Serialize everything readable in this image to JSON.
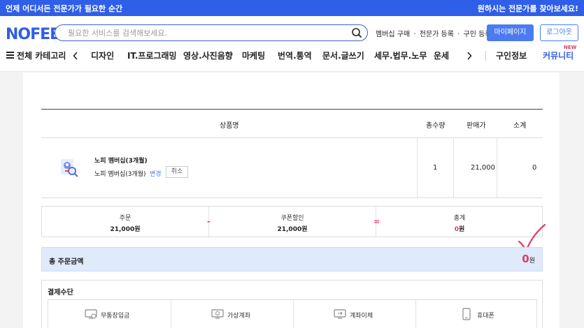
{
  "promo": {
    "left": "언제 어디서든 전문가가 필요한 순간",
    "right": "원하시는 전문가를 찾아보세요!"
  },
  "header": {
    "logo": "NOFEE",
    "search_placeholder": "필요한 서비스를 검색해보세요.",
    "links": [
      "멤버십 구매",
      "·",
      "전문가 등록",
      "·",
      "구인 등록"
    ],
    "mypage_label": "마이페이지",
    "logout_label": "로그아웃"
  },
  "nav": {
    "all_categories": "전체 카테고리",
    "categories": [
      "디자인",
      "IT.프로그래밍",
      "영상.사진음향",
      "마케팅",
      "번역.통역",
      "문서.글쓰기",
      "세무.법무.노무",
      "운세"
    ],
    "jobs": "구인정보",
    "community": "커뮤니티",
    "new_badge": "NEW"
  },
  "table": {
    "headers": {
      "product": "상품명",
      "quantity": "총수량",
      "price": "판매가",
      "subtotal": "소계"
    },
    "row": {
      "name": "노피 멤버십(3개월)",
      "option": "노피 멤버십(3개월)",
      "change_label": "변경",
      "cancel_label": "취소",
      "quantity": "1",
      "price": "21,000",
      "subtotal": "0"
    }
  },
  "summary": {
    "order_label": "주문",
    "order_value": "21,000원",
    "coupon_label": "쿠폰할인",
    "coupon_value": "21,000원",
    "total_label": "총계",
    "total_value": "0",
    "total_unit": "원",
    "minus": "-",
    "equals": "="
  },
  "total_order": {
    "label": "총 주문금액",
    "value": "0",
    "unit": "원"
  },
  "payment": {
    "title": "결제수단",
    "methods": [
      "무통장입금",
      "가상계좌",
      "계좌이체",
      "휴대폰"
    ]
  },
  "colors": {
    "brand": "#2f5fe8",
    "accent_pink": "#e03b6b",
    "total_bg": "#dfeafb"
  }
}
